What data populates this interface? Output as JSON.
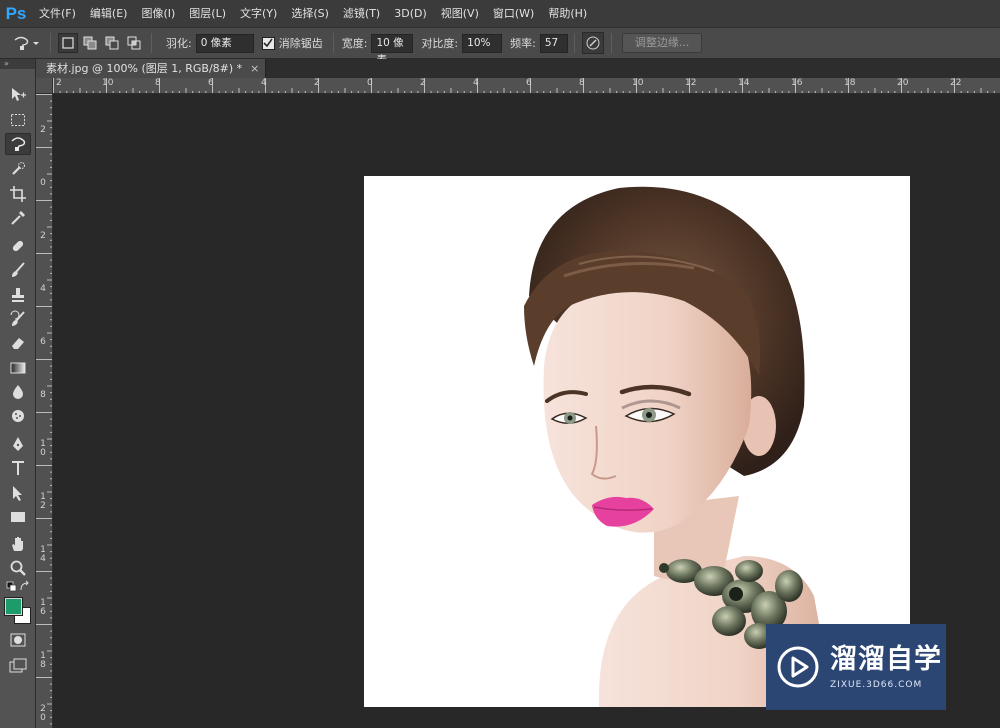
{
  "app": {
    "logo": "Ps"
  },
  "menu": [
    "文件(F)",
    "编辑(E)",
    "图像(I)",
    "图层(L)",
    "文字(Y)",
    "选择(S)",
    "滤镜(T)",
    "3D(D)",
    "视图(V)",
    "窗口(W)",
    "帮助(H)"
  ],
  "options": {
    "feather_label": "羽化:",
    "feather_value": "0 像素",
    "antialias_label": "消除锯齿",
    "antialias_checked": true,
    "width_label": "宽度:",
    "width_value": "10 像素",
    "contrast_label": "对比度:",
    "contrast_value": "10%",
    "frequency_label": "频率:",
    "frequency_value": "57",
    "refine_edge_label": "调整边缘..."
  },
  "document_tab": {
    "title": "素材.jpg @ 100% (图层 1, RGB/8#) *",
    "close": "×"
  },
  "toolbox": {
    "header": "»"
  },
  "ruler_h": [
    "2",
    "10",
    "8",
    "6",
    "4",
    "2",
    "0",
    "2",
    "4",
    "6",
    "8",
    "10",
    "12",
    "14",
    "16",
    "18",
    "20",
    "22"
  ],
  "ruler_v": [
    "2",
    "0",
    "2",
    "4",
    "6",
    "8",
    "10",
    "12",
    "14",
    "16",
    "18",
    "20"
  ],
  "colors": {
    "foreground": "#1e9b6a",
    "background": "#ffffff",
    "accent": "#31a8ff"
  },
  "watermark": {
    "title": "溜溜自学",
    "url": "ZIXUE.3D66.COM"
  }
}
